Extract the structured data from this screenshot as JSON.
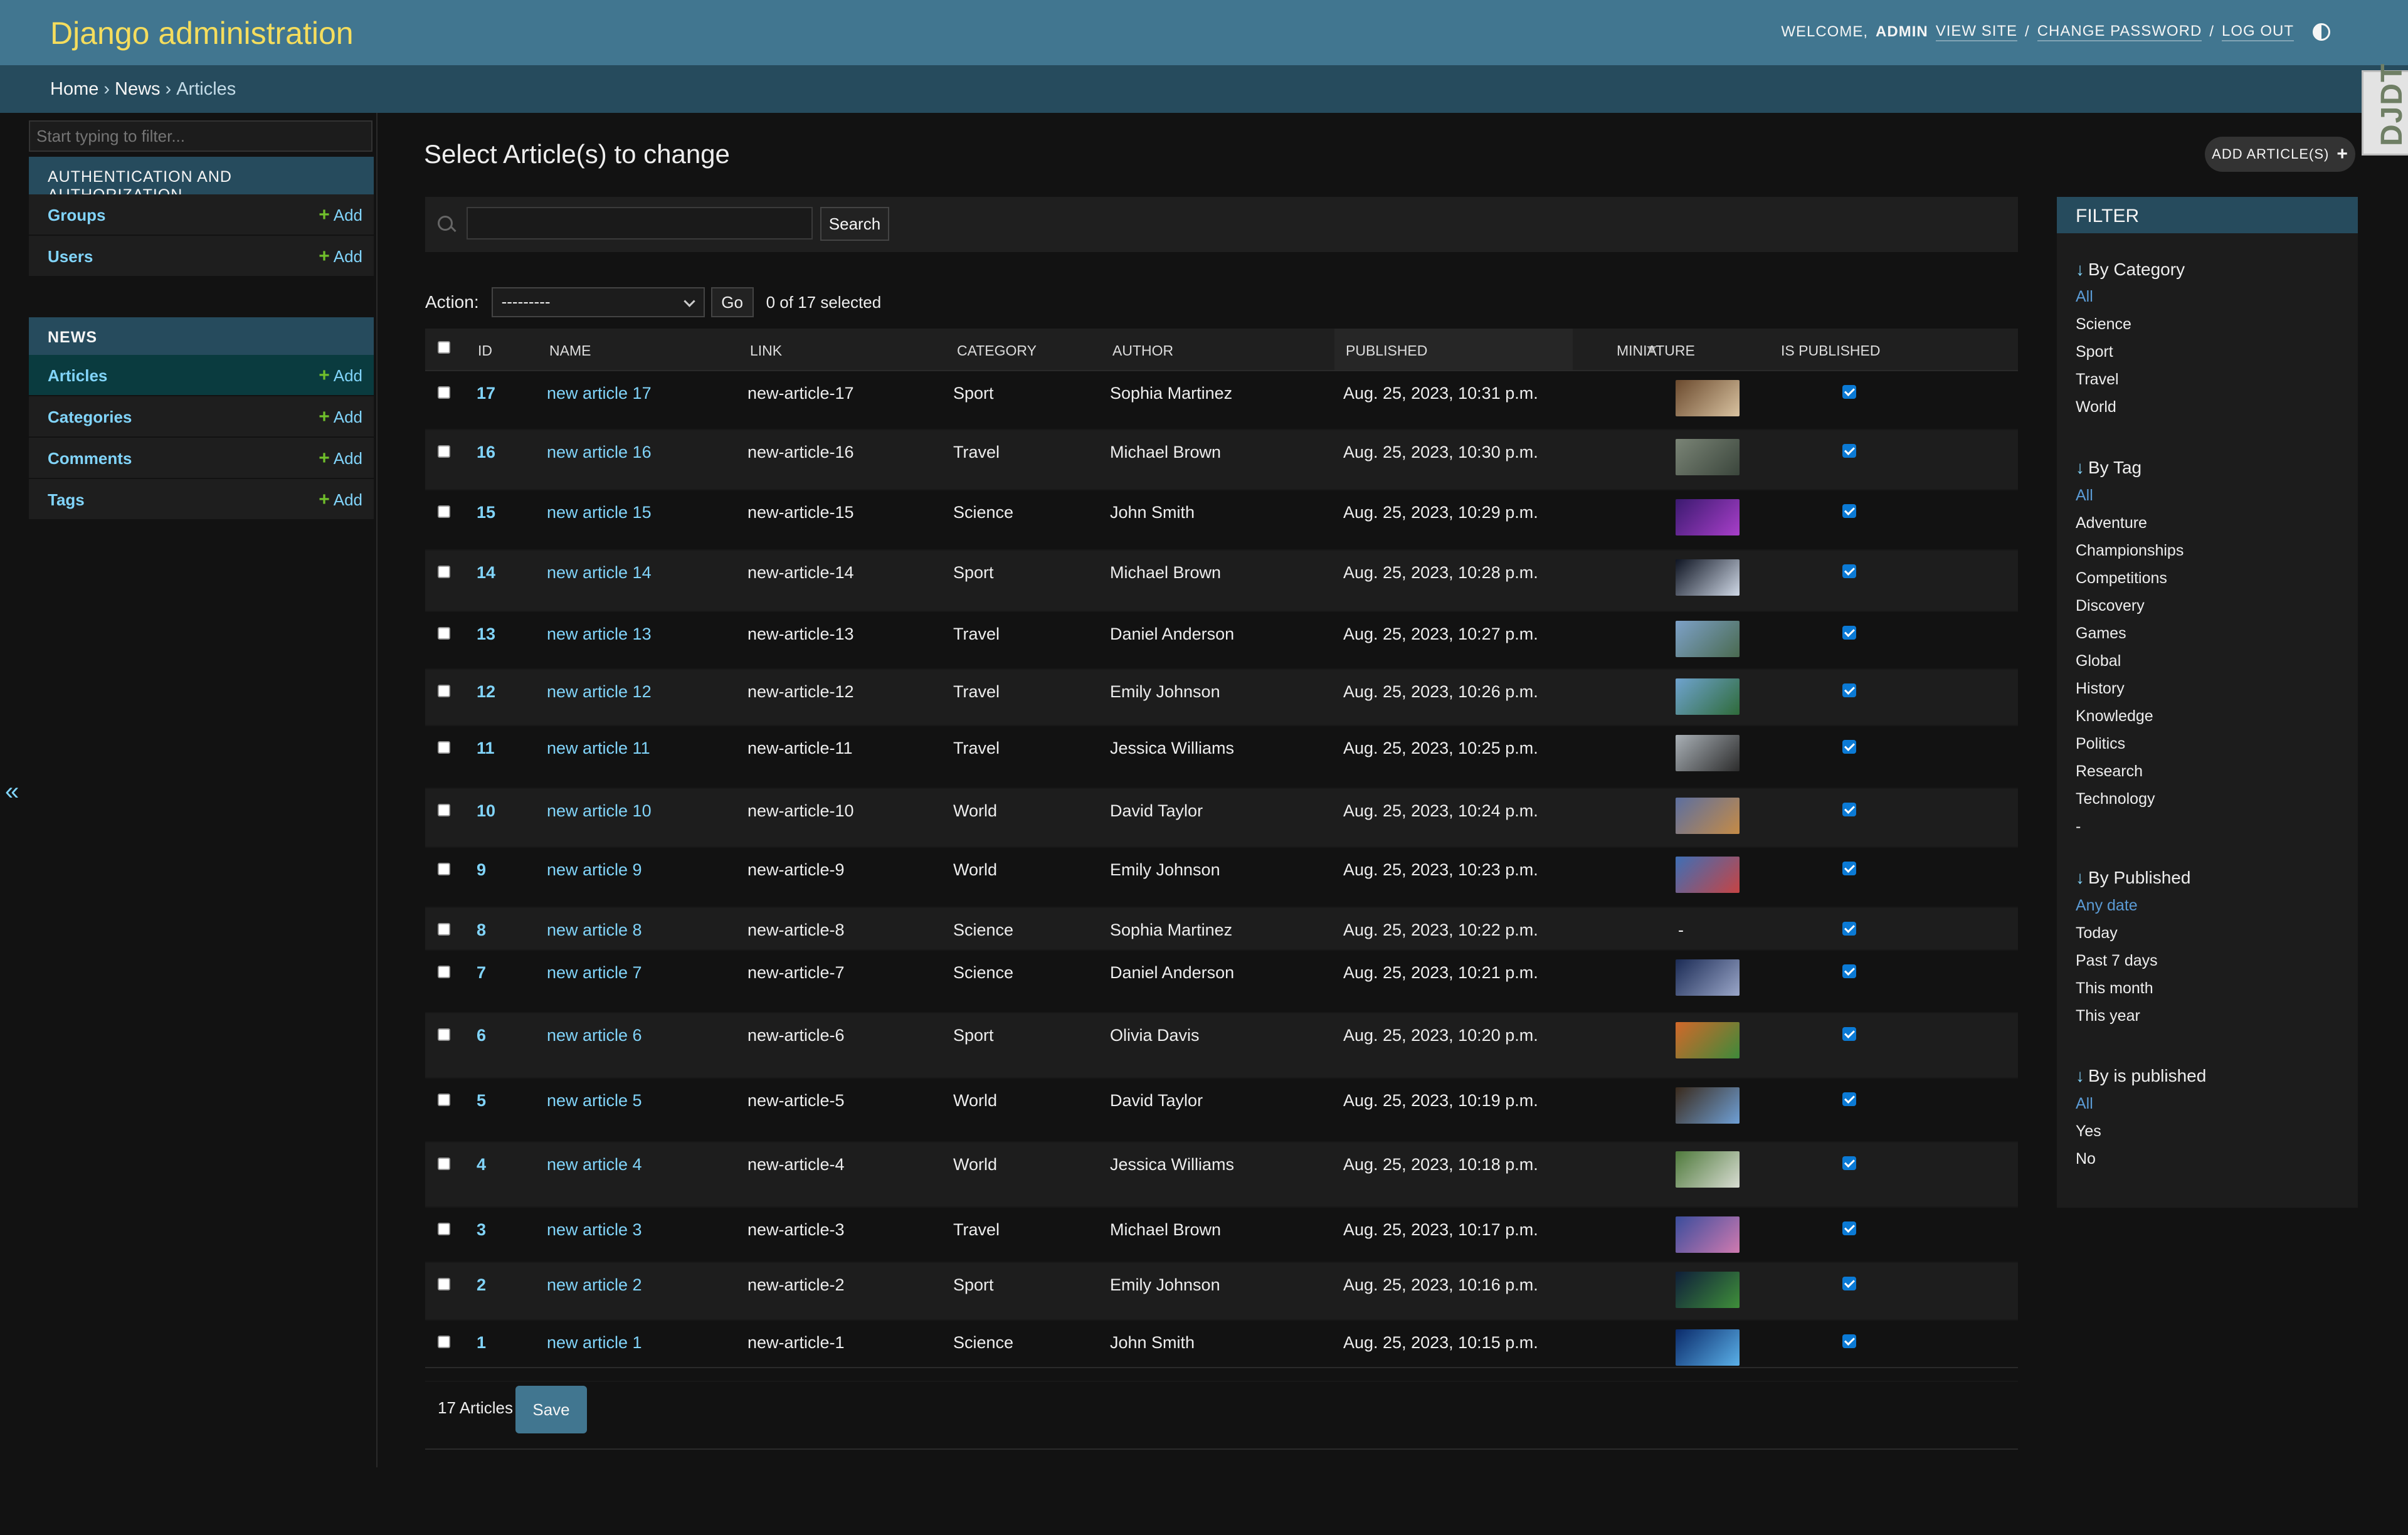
{
  "header": {
    "brand": "Django administration",
    "welcome": "Welcome,",
    "user": "ADMIN",
    "view_site": "View site",
    "change_password": "Change password",
    "log_out": "Log out",
    "slash": "/"
  },
  "breadcrumbs": [
    "Home",
    "News",
    "Articles"
  ],
  "djdt_label": "DJDT",
  "sidebar": {
    "filter_placeholder": "Start typing to filter...",
    "apps": [
      {
        "caption": "Authentication and Authorization",
        "models": [
          {
            "name": "Groups",
            "add": "Add"
          },
          {
            "name": "Users",
            "add": "Add"
          }
        ]
      },
      {
        "caption": "News",
        "models": [
          {
            "name": "Articles",
            "add": "Add"
          },
          {
            "name": "Categories",
            "add": "Add"
          },
          {
            "name": "Comments",
            "add": "Add"
          },
          {
            "name": "Tags",
            "add": "Add"
          }
        ]
      }
    ]
  },
  "page": {
    "title": "Select Article(s) to change",
    "add_button": "Add Article(s)",
    "search_button": "Search",
    "action_label": "Action:",
    "action_default": "---------",
    "go_button": "Go",
    "selected_count": "0 of 17 selected",
    "total": "17 Articles",
    "save_button": "Save"
  },
  "table": {
    "columns": [
      "ID",
      "Name",
      "Link",
      "Category",
      "Author",
      "Published",
      "Miniature",
      "Is published"
    ],
    "rows": [
      {
        "id": "17",
        "name": "new article 17",
        "link": "new-article-17",
        "category": "Sport",
        "author": "Sophia Martinez",
        "published": "Aug. 25, 2023, 10:31 p.m.",
        "miniature": "image",
        "thumb_colors": [
          "#6b4a2e",
          "#d8c2a0"
        ],
        "is_published": true
      },
      {
        "id": "16",
        "name": "new article 16",
        "link": "new-article-16",
        "category": "Travel",
        "author": "Michael Brown",
        "published": "Aug. 25, 2023, 10:30 p.m.",
        "miniature": "image",
        "thumb_colors": [
          "#7a8476",
          "#3b463c"
        ],
        "is_published": true
      },
      {
        "id": "15",
        "name": "new article 15",
        "link": "new-article-15",
        "category": "Science",
        "author": "John Smith",
        "published": "Aug. 25, 2023, 10:29 p.m.",
        "miniature": "image",
        "thumb_colors": [
          "#3b1a70",
          "#a83fc9"
        ],
        "is_published": true
      },
      {
        "id": "14",
        "name": "new article 14",
        "link": "new-article-14",
        "category": "Sport",
        "author": "Michael Brown",
        "published": "Aug. 25, 2023, 10:28 p.m.",
        "miniature": "image",
        "thumb_colors": [
          "#0e1422",
          "#cfd8e6"
        ],
        "is_published": true
      },
      {
        "id": "13",
        "name": "new article 13",
        "link": "new-article-13",
        "category": "Travel",
        "author": "Daniel Anderson",
        "published": "Aug. 25, 2023, 10:27 p.m.",
        "miniature": "image",
        "thumb_colors": [
          "#7da1c8",
          "#4a6a50"
        ],
        "is_published": true
      },
      {
        "id": "12",
        "name": "new article 12",
        "link": "new-article-12",
        "category": "Travel",
        "author": "Emily Johnson",
        "published": "Aug. 25, 2023, 10:26 p.m.",
        "miniature": "image",
        "thumb_colors": [
          "#6fa3cf",
          "#2f6b3a"
        ],
        "is_published": true
      },
      {
        "id": "11",
        "name": "new article 11",
        "link": "new-article-11",
        "category": "Travel",
        "author": "Jessica Williams",
        "published": "Aug. 25, 2023, 10:25 p.m.",
        "miniature": "image",
        "thumb_colors": [
          "#a9b0b6",
          "#2c2c2c"
        ],
        "is_published": true
      },
      {
        "id": "10",
        "name": "new article 10",
        "link": "new-article-10",
        "category": "World",
        "author": "David Taylor",
        "published": "Aug. 25, 2023, 10:24 p.m.",
        "miniature": "image",
        "thumb_colors": [
          "#5c6fa0",
          "#c58b46"
        ],
        "is_published": true
      },
      {
        "id": "9",
        "name": "new article 9",
        "link": "new-article-9",
        "category": "World",
        "author": "Emily Johnson",
        "published": "Aug. 25, 2023, 10:23 p.m.",
        "miniature": "image",
        "thumb_colors": [
          "#3e6fb6",
          "#c64444"
        ],
        "is_published": true
      },
      {
        "id": "8",
        "name": "new article 8",
        "link": "new-article-8",
        "category": "Science",
        "author": "Sophia Martinez",
        "published": "Aug. 25, 2023, 10:22 p.m.",
        "miniature": "-",
        "thumb_colors": [],
        "is_published": true
      },
      {
        "id": "7",
        "name": "new article 7",
        "link": "new-article-7",
        "category": "Science",
        "author": "Daniel Anderson",
        "published": "Aug. 25, 2023, 10:21 p.m.",
        "miniature": "image",
        "thumb_colors": [
          "#1b2b55",
          "#9aa6c8"
        ],
        "is_published": true
      },
      {
        "id": "6",
        "name": "new article 6",
        "link": "new-article-6",
        "category": "Sport",
        "author": "Olivia Davis",
        "published": "Aug. 25, 2023, 10:20 p.m.",
        "miniature": "image",
        "thumb_colors": [
          "#d2682a",
          "#3e8a3a"
        ],
        "is_published": true
      },
      {
        "id": "5",
        "name": "new article 5",
        "link": "new-article-5",
        "category": "World",
        "author": "David Taylor",
        "published": "Aug. 25, 2023, 10:19 p.m.",
        "miniature": "image",
        "thumb_colors": [
          "#3a2a1c",
          "#6fa0d6"
        ],
        "is_published": true
      },
      {
        "id": "4",
        "name": "new article 4",
        "link": "new-article-4",
        "category": "World",
        "author": "Jessica Williams",
        "published": "Aug. 25, 2023, 10:18 p.m.",
        "miniature": "image",
        "thumb_colors": [
          "#4f7a3c",
          "#d8dcd2"
        ],
        "is_published": true
      },
      {
        "id": "3",
        "name": "new article 3",
        "link": "new-article-3",
        "category": "Travel",
        "author": "Michael Brown",
        "published": "Aug. 25, 2023, 10:17 p.m.",
        "miniature": "image",
        "thumb_colors": [
          "#3a4d9c",
          "#d07ab0"
        ],
        "is_published": true
      },
      {
        "id": "2",
        "name": "new article 2",
        "link": "new-article-2",
        "category": "Sport",
        "author": "Emily Johnson",
        "published": "Aug. 25, 2023, 10:16 p.m.",
        "miniature": "image",
        "thumb_colors": [
          "#0f1e3a",
          "#3f8f3a"
        ],
        "is_published": true
      },
      {
        "id": "1",
        "name": "new article 1",
        "link": "new-article-1",
        "category": "Science",
        "author": "John Smith",
        "published": "Aug. 25, 2023, 10:15 p.m.",
        "miniature": "image",
        "thumb_colors": [
          "#0a2a6a",
          "#5ab0e8"
        ],
        "is_published": true
      }
    ]
  },
  "filter": {
    "caption": "Filter",
    "groups": [
      {
        "title": "By Category",
        "items": [
          "All",
          "Science",
          "Sport",
          "Travel",
          "World"
        ],
        "selected": 0
      },
      {
        "title": "By Tag",
        "items": [
          "All",
          "Adventure",
          "Championships",
          "Competitions",
          "Discovery",
          "Games",
          "Global",
          "History",
          "Knowledge",
          "Politics",
          "Research",
          "Technology",
          "-"
        ],
        "selected": 0
      },
      {
        "title": "By Published",
        "items": [
          "Any date",
          "Today",
          "Past 7 days",
          "This month",
          "This year"
        ],
        "selected": 0
      },
      {
        "title": "By is published",
        "items": [
          "All",
          "Yes",
          "No"
        ],
        "selected": 0
      }
    ]
  },
  "colors": {
    "header": "#417690",
    "breadcrumbs": "#264b5d",
    "brand": "#f5dd5d",
    "link": "#81d4fa",
    "add_plus": "#70bf2b",
    "checkbox": "#0b7ad5"
  }
}
